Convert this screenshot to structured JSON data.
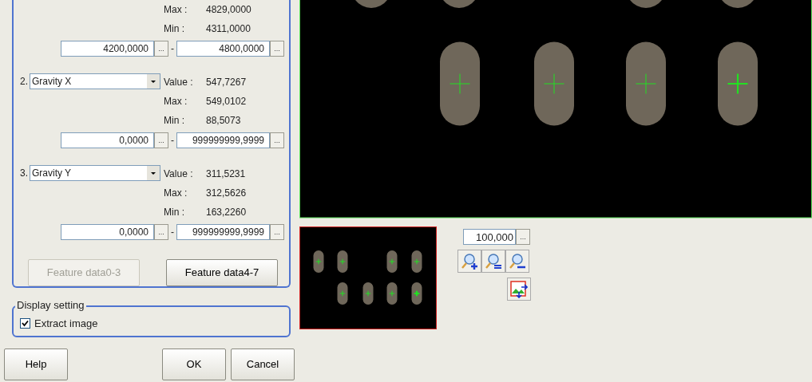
{
  "features": [
    {
      "readings": [
        {
          "label": "Max :",
          "value": "4829,0000"
        },
        {
          "label": "Min :",
          "value": "4311,0000"
        }
      ],
      "range": {
        "lower": "4200,0000",
        "upper": "4800,0000",
        "separator": "-",
        "button": "..."
      }
    },
    {
      "number": "2.",
      "item": "Gravity X",
      "readings": [
        {
          "label": "Value :",
          "value": "547,7267"
        },
        {
          "label": "Max :",
          "value": "549,0102"
        },
        {
          "label": "Min :",
          "value": "88,5073"
        }
      ],
      "range": {
        "lower": "0,0000",
        "upper": "999999999,9999",
        "separator": "-",
        "button": "..."
      }
    },
    {
      "number": "3.",
      "item": "Gravity Y",
      "readings": [
        {
          "label": "Value :",
          "value": "311,5231"
        },
        {
          "label": "Max :",
          "value": "312,5626"
        },
        {
          "label": "Min :",
          "value": "163,2260"
        }
      ],
      "range": {
        "lower": "0,0000",
        "upper": "999999999,9999",
        "separator": "-",
        "button": "..."
      }
    }
  ],
  "page_buttons": [
    {
      "label": "Feature data0-3",
      "disabled": true
    },
    {
      "label": "Feature data4-7",
      "disabled": false
    }
  ],
  "display_setting": {
    "title": "Display setting",
    "checkbox": {
      "label": "Extract image",
      "checked": true
    }
  },
  "footer_buttons": [
    "Help",
    "OK",
    "Cancel"
  ],
  "zoom": {
    "value": "100,000",
    "button": "..."
  }
}
